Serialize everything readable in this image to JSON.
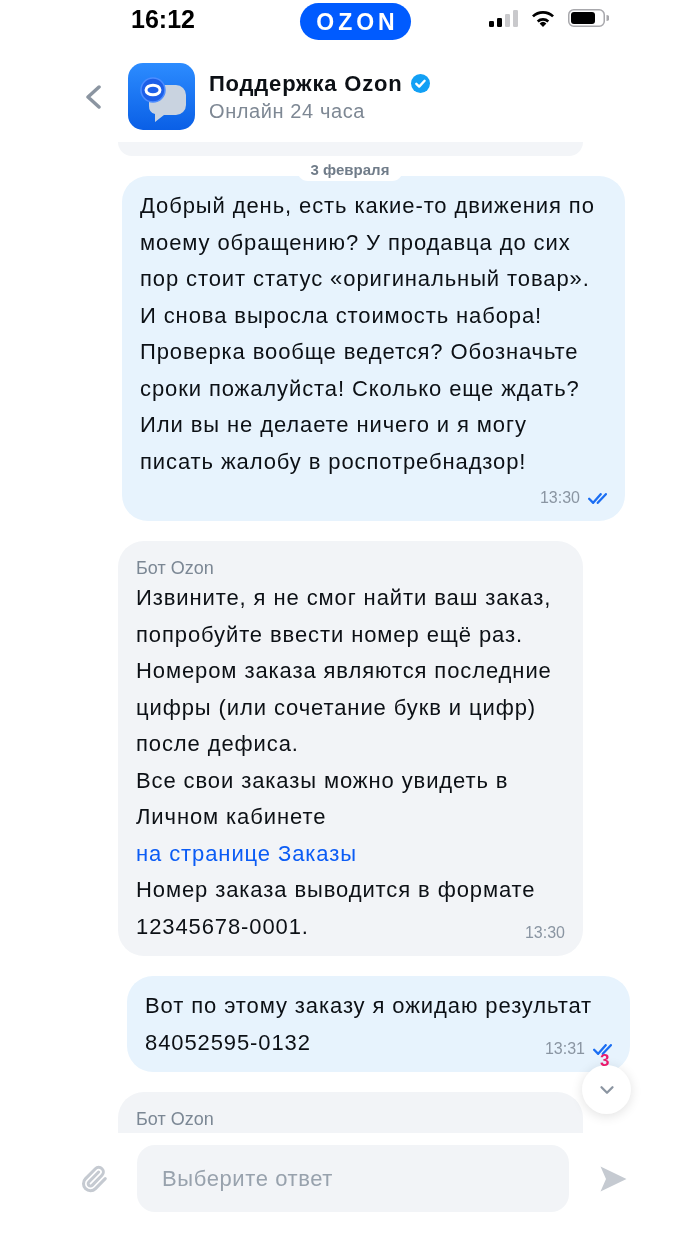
{
  "status_bar": {
    "time": "16:12",
    "logo": "OZON"
  },
  "header": {
    "title": "Поддержка Ozon",
    "verified": true,
    "subtitle": "Онлайн 24 часа"
  },
  "messages": [
    {
      "kind": "incoming",
      "partial": true
    },
    {
      "kind": "date",
      "text": "3 февраля"
    },
    {
      "kind": "outgoing",
      "partial": false,
      "paragraphs": [
        {
          "text": "Добрый день, есть какие-то движения по моему обращению? У продавца до сих пор стоит статус «оригинальный товар». И снова выросла стоимость набора! Проверка вообще ведется? Обозначьте сроки пожалуйста! Сколько еще ждать? Или вы не делаете ничего и я могу писать жалобу в роспотребнадзор!"
        }
      ],
      "time": "13:30",
      "read": true
    },
    {
      "kind": "incoming",
      "partial": false,
      "sender": "Бот Ozon",
      "paragraphs": [
        {
          "text": "Извините, я не смог найти ваш заказ, попробуйте ввести номер ещё раз."
        },
        {
          "text": "Номером заказа являются последние цифры (или сочетание букв и цифр) после дефиса."
        },
        {
          "text": "Все свои заказы можно увидеть в Личном кабинете",
          "link": "на странице Заказы"
        },
        {
          "text": "Номер заказа выводится в формате"
        },
        {
          "text": "12345678-0001."
        }
      ],
      "time": "13:30"
    },
    {
      "kind": "outgoing",
      "partial": false,
      "paragraphs": [
        {
          "text": "Вот по этому заказу я ожидаю результат"
        },
        {
          "text": "84052595-0132"
        }
      ],
      "time": "13:31",
      "read": true
    },
    {
      "kind": "incoming",
      "partial": true,
      "sender": "Бот Ozon"
    }
  ],
  "scroll_down_button": {
    "badge": "3"
  },
  "composer": {
    "placeholder": "Выберите ответ"
  }
}
